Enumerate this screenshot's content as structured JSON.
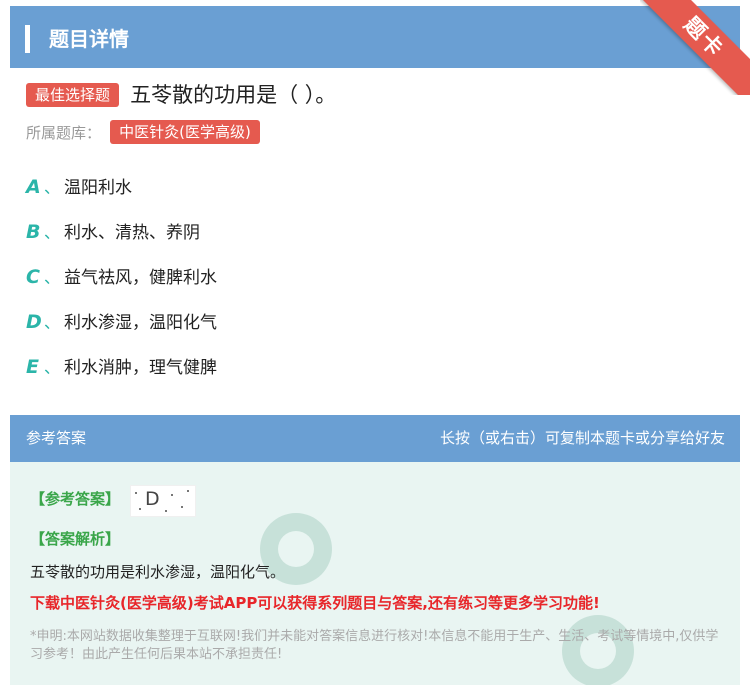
{
  "header": {
    "title": "题目详情",
    "ribbon": "题卡"
  },
  "question": {
    "type_tag": "最佳选择题",
    "text": "五苓散的功用是（ ）。",
    "bank_label": "所属题库：",
    "bank_name": "中医针灸(医学高级)"
  },
  "options": [
    {
      "letter": "A",
      "sep": "、",
      "text": "温阳利水"
    },
    {
      "letter": "B",
      "sep": "、",
      "text": "利水、清热、养阴"
    },
    {
      "letter": "C",
      "sep": "、",
      "text": "益气祛风，健脾利水"
    },
    {
      "letter": "D",
      "sep": "、",
      "text": "利水渗湿，温阳化气"
    },
    {
      "letter": "E",
      "sep": "、",
      "text": "利水消肿，理气健脾"
    }
  ],
  "answer_section": {
    "title": "参考答案",
    "hint": "长按（或右击）可复制本题卡或分享给好友",
    "answer_label": "【参考答案】",
    "answer_value": "D",
    "analysis_label": "【答案解析】",
    "analysis_text": "五苓散的功用是利水渗湿，温阳化气。",
    "download_text": "下载中医针灸(医学高级)考试APP可以获得系列题目与答案,还有练习等更多学习功能!",
    "disclaimer": "*申明:本网站数据收集整理于互联网!我们并未能对答案信息进行核对!本信息不能用于生产、生活、考试等情境中,仅供学习参考！由此产生任何后果本站不承担责任!"
  },
  "colors": {
    "header_blue": "#6a9fd3",
    "tag_red": "#e55a4f",
    "option_teal": "#2bb5a9",
    "answer_green": "#3aa64a",
    "download_red": "#e8262a",
    "answer_bg": "#e9f5f2"
  }
}
